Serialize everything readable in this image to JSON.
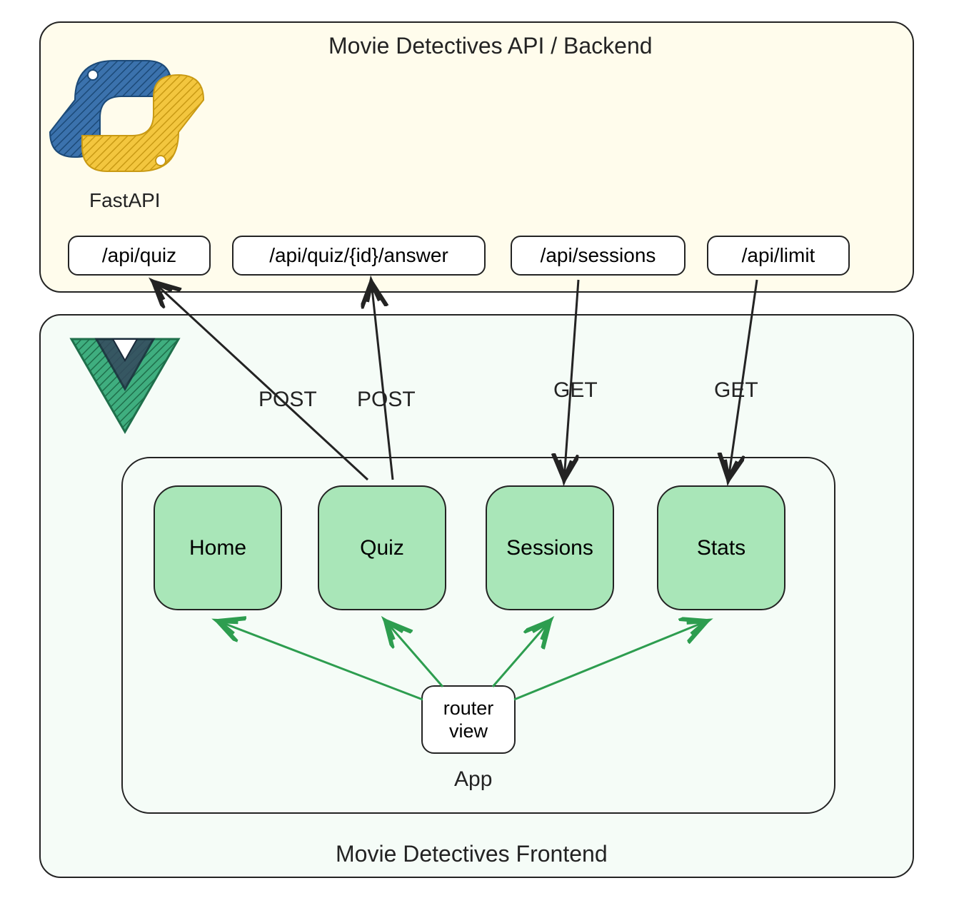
{
  "backend": {
    "title": "Movie Detectives API / Backend",
    "logo_label": "FastAPI",
    "endpoints": [
      "/api/quiz",
      "/api/quiz/{id}/answer",
      "/api/sessions",
      "/api/limit"
    ]
  },
  "frontend": {
    "title": "Movie Detectives Frontend",
    "logo_name": "vue-icon",
    "app_label": "App",
    "router_label_line1": "router",
    "router_label_line2": "view",
    "components": [
      "Home",
      "Quiz",
      "Sessions",
      "Stats"
    ]
  },
  "arrows": [
    {
      "method": "POST"
    },
    {
      "method": "POST"
    },
    {
      "method": "GET"
    },
    {
      "method": "GET"
    }
  ],
  "colors": {
    "backend_bg": "#fffcec",
    "frontend_bg": "#f5fcf7",
    "component_bg": "#a9e6b8",
    "router_arrow": "#2d9d4f",
    "stroke": "#232323"
  }
}
